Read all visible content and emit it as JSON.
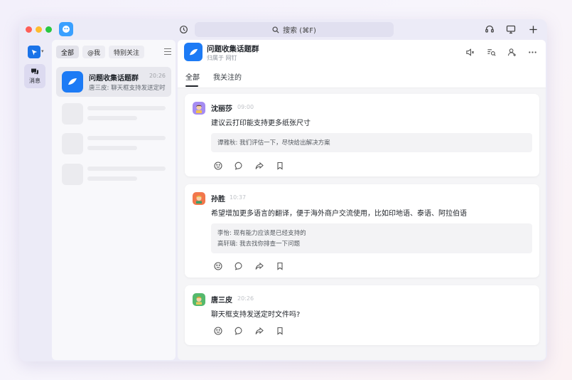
{
  "titlebar": {
    "search_placeholder": "搜索 (⌘F)"
  },
  "rail": {
    "messages_label": "消息"
  },
  "filters": [
    {
      "label": "全部"
    },
    {
      "label": "@我"
    },
    {
      "label": "特别关注"
    }
  ],
  "conversation": {
    "name": "问题收集话题群",
    "time": "20:26",
    "preview": "唐三皮: 聊天框支持发送定时文件吗?"
  },
  "chat": {
    "title": "问题收集话题群",
    "subtitle": "归属于 网钉",
    "tabs": [
      "全部",
      "我关注的"
    ]
  },
  "posts": [
    {
      "author": "沈丽莎",
      "time": "09:00",
      "text": "建议云打印能支持更多纸张尺寸",
      "replies": [
        "谭雅秋: 我们评估一下，尽快给出解决方案"
      ]
    },
    {
      "author": "孙胜",
      "time": "10:37",
      "text": "希望增加更多语言的翻译，便于海外商户交流使用，比如印地语、泰语、阿拉伯语",
      "replies": [
        "李怡: 现有能力应该是已经支持的",
        "高轩璃: 我去找你排查一下问题"
      ]
    },
    {
      "author": "唐三皮",
      "time": "20:26",
      "text": "聊天框支持发送定时文件吗?",
      "replies": []
    }
  ],
  "colors": {
    "accent": "#1d7bf5",
    "window_bg": "#ecebf7"
  }
}
